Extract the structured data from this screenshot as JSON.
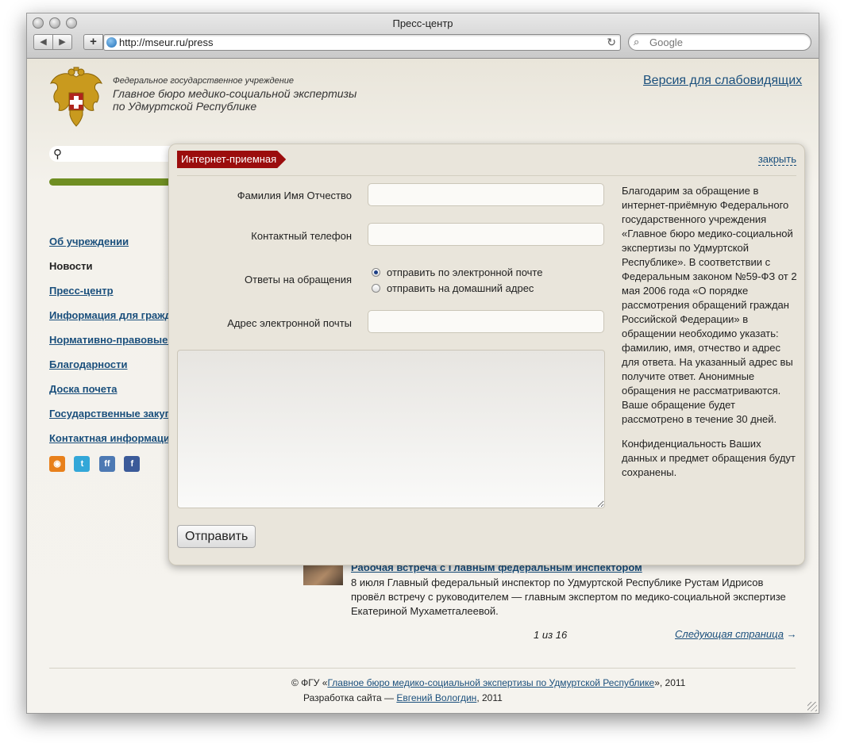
{
  "browser": {
    "window_title": "Пресс-центр",
    "back_label": "◀",
    "forward_label": "▶",
    "add_label": "+",
    "url": "http://mseur.ru/press",
    "search_placeholder": "Google"
  },
  "header": {
    "org_subtitle": "Федеральное государственное учреждение",
    "org_name_line1": "Главное бюро медико-социальной экспертизы",
    "org_name_line2": "по Удмуртской Республике",
    "accessible_link": "Версия для слабовидящих"
  },
  "sidebar": {
    "search_value": "",
    "items": [
      {
        "label": "Об учреждении"
      },
      {
        "label": "Новости"
      },
      {
        "label": "Пресс-центр"
      },
      {
        "label": "Информация для граждан"
      },
      {
        "label": "Нормативно-правовые акты"
      },
      {
        "label": "Благодарности"
      },
      {
        "label": "Доска почета"
      },
      {
        "label": "Государственные закупки"
      },
      {
        "label": "Контактная информация"
      }
    ],
    "social": [
      "rss-icon",
      "twitter-icon",
      "friendfeed-icon",
      "facebook-icon"
    ]
  },
  "modal": {
    "tab_label": "Интернет-приемная",
    "close_label": "закрыть",
    "fields": {
      "name_label": "Фамилия Имя Отчество",
      "phone_label": "Контактный телефон",
      "answers_label": "Ответы на обращения",
      "email_label": "Адрес электронной почты"
    },
    "radios": [
      {
        "label": "отправить по электронной почте",
        "checked": true
      },
      {
        "label": "отправить на домашний адрес",
        "checked": false
      }
    ],
    "message_value": "",
    "submit_label": "Отправить",
    "info_p1": "Благодарим за обращение в интернет-приёмную Федерального государственного учреждения «Главное бюро медико-социальной экспертизы по Удмуртской Республике». В соответствии с Федеральным законом №59-ФЗ от 2 мая 2006 года «О порядке рассмотрения обращений граждан Российской Федерации» в обращении необходимо указать: фамилию, имя, отчество и адрес для ответа. На указанный адрес вы получите ответ. Анонимные обращения не рассматриваются. Ваше обращение будет рассмотрено в течение 30 дней.",
    "info_p2": "Конфиденциальность Ваших данных и предмет обращения будут сохранены."
  },
  "news": {
    "title": "Рабочая встреча с Главным федеральным инспектором",
    "text": "8 июля Главный федеральный инспектор по Удмуртской Республике Рустам Идрисов провёл встречу с руководителем — главным экспертом по медико-социальной экспертизе Екатериной Мухаметгалеевой."
  },
  "pager": {
    "count": "1 из 16",
    "next_label": "Следующая страница",
    "next_arrow": "→"
  },
  "footer": {
    "copyright_prefix": "© ФГУ «",
    "org_link": "Главное бюро медико-социальной экспертизы по Удмуртской Республике",
    "copyright_suffix": "», 2011",
    "dev_prefix": "Разработка сайта — ",
    "dev_link": "Евгений Вологдин",
    "dev_suffix": ", 2011"
  }
}
